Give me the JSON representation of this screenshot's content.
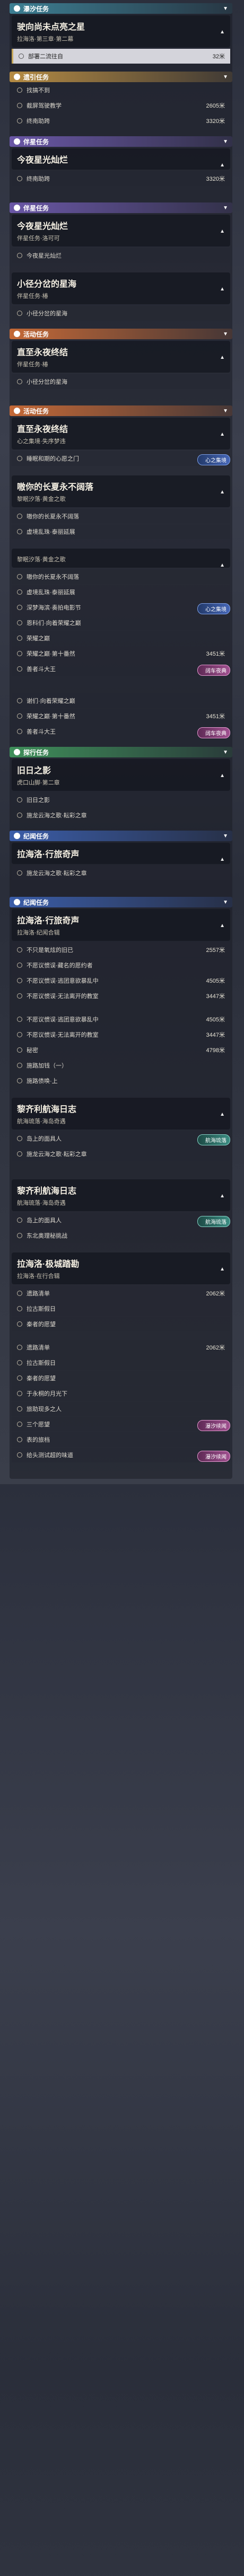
{
  "sections": [
    {
      "type": "header",
      "color": "cyan",
      "title": "瀑汐任务",
      "cards": [
        {
          "title": "驶向尚未点亮之星",
          "sub": "拉海洛·第三章·第二幕",
          "light": false
        }
      ],
      "steps": [
        {
          "label": "部署二流往自",
          "dist": "32米",
          "selected": true
        }
      ]
    },
    {
      "type": "header",
      "color": "gold",
      "title": "遗引任务",
      "steps": [
        {
          "label": "找搞不到",
          "dist": ""
        },
        {
          "label": "截屏驾驶教学",
          "dist": "2605米"
        },
        {
          "label": "终南助跨",
          "dist": "3320米"
        }
      ]
    },
    {
      "type": "header",
      "color": "purple",
      "title": "伴星任务",
      "cards": [
        {
          "title": "今夜星光灿烂",
          "sub": "",
          "light": false
        }
      ],
      "steps": [
        {
          "label": "终南助跨",
          "dist": "3320米"
        }
      ]
    },
    {
      "type": "header",
      "color": "purple",
      "title": "伴星任务",
      "cards": [
        {
          "title": "今夜星光灿烂",
          "sub": "伴星任务·洛可可",
          "light": false
        }
      ],
      "steps": [
        {
          "label": "今夜星光灿烂",
          "dist": ""
        }
      ]
    },
    {
      "type": "plain",
      "cards": [
        {
          "title": "小径分岔的星海",
          "sub": "伴星任务·椿",
          "light": false
        }
      ],
      "steps": [
        {
          "label": "小径分岔的星海",
          "dist": ""
        }
      ]
    },
    {
      "type": "header",
      "color": "orange",
      "title": "活动任务",
      "cards": [
        {
          "title": "直至永夜终结",
          "sub": "伴星任务·椿",
          "light": false
        }
      ],
      "steps": [
        {
          "label": "小径分岔的星海",
          "dist": ""
        }
      ]
    },
    {
      "type": "header",
      "color": "orange",
      "title": "活动任务",
      "cards": [
        {
          "title": "直至永夜终结",
          "sub": "心之集境·失序梦违",
          "light": false
        }
      ],
      "steps": [
        {
          "label": "睡眠和期的心愿之门",
          "dist": "",
          "badge": "心之集境",
          "badge_color": "blue"
        }
      ],
      "badge_on_card": false
    },
    {
      "type": "plain",
      "cards": [
        {
          "title": "嗷你的长夏永不阔落",
          "sub": "黎眠汐落·黄金之歌",
          "light": false
        }
      ],
      "steps": [
        {
          "label": "嗷你的长夏永不阔落",
          "dist": ""
        },
        {
          "label": "虚境乱珠·泰丽延展",
          "dist": ""
        }
      ]
    },
    {
      "type": "plain",
      "cards": [
        {
          "title": "",
          "sub": "黎眠汐落·黄金之歌",
          "light": false
        }
      ],
      "steps": [
        {
          "label": "嗷你的长夏永不阔落",
          "dist": ""
        },
        {
          "label": "虚境乱珠·泰丽延展",
          "dist": ""
        },
        {
          "label": "深梦海滨·奏拍电影节",
          "dist": "",
          "badge": "心之集境",
          "badge_color": "blue"
        },
        {
          "label": "恩科们·向着荣耀之巅",
          "dist": ""
        },
        {
          "label": "荣耀之巅",
          "dist": ""
        },
        {
          "label": "荣耀之巅·第十番然",
          "dist": "3451米"
        },
        {
          "label": "善者斗大王",
          "dist": "",
          "badge": "阔车夜典",
          "badge_color": "pink"
        }
      ]
    },
    {
      "type": "plain",
      "steps": [
        {
          "label": "谢们·向着荣耀之巅",
          "dist": ""
        },
        {
          "label": "荣耀之巅·第十番然",
          "dist": "3451米"
        },
        {
          "label": "善者斗大王",
          "dist": "",
          "badge": "阔车夜典",
          "badge_color": "pink"
        }
      ]
    },
    {
      "type": "header",
      "color": "green",
      "title": "探行任务",
      "cards": [
        {
          "title": "旧日之影",
          "sub": "虎口山脚·第二章",
          "light": false
        }
      ],
      "steps": [
        {
          "label": "旧日之影",
          "dist": ""
        },
        {
          "label": "施龙云海之歌·耘彩之章",
          "dist": ""
        }
      ]
    },
    {
      "type": "header",
      "color": "blue",
      "title": "纪闻任务",
      "cards": [
        {
          "title": "拉海洛·行旅奇声",
          "sub": "",
          "light": false
        }
      ],
      "steps": [
        {
          "label": "施龙云海之歌·耘彩之章",
          "dist": ""
        }
      ]
    },
    {
      "type": "header",
      "color": "blue",
      "title": "纪闻任务",
      "cards": [
        {
          "title": "拉海洛·行旅奇声",
          "sub": "拉海洛·纪闻合辑",
          "light": false
        }
      ],
      "steps": [
        {
          "label": "不只是氧炫的旧已",
          "dist": "2557米"
        },
        {
          "label": "不愿议惯误·藏名的愿约者",
          "dist": ""
        },
        {
          "label": "不愿议惯误·逃团意欲暴乱中",
          "dist": "4505米"
        },
        {
          "label": "不愿议惯误·无法离开的教室",
          "dist": "3447米"
        }
      ]
    },
    {
      "type": "plain",
      "steps": [
        {
          "label": "不愿议惯误·逃团意欲暴乱中",
          "dist": "4505米"
        },
        {
          "label": "不愿议惯误·无法离开的教室",
          "dist": "3447米"
        },
        {
          "label": "秘密",
          "dist": "4798米"
        },
        {
          "label": "施路加钱（一）",
          "dist": ""
        },
        {
          "label": "施路债唤·上",
          "dist": ""
        }
      ]
    },
    {
      "type": "plain",
      "cards": [
        {
          "title": "黎齐利航海日志",
          "sub": "航海琉落·海岛奇遇",
          "light": false
        }
      ],
      "steps": [
        {
          "label": "岛上的面具人",
          "dist": "",
          "badge": "航海琉落",
          "badge_color": "teal"
        },
        {
          "label": "施龙云海之歌·耘彩之章",
          "dist": ""
        }
      ]
    },
    {
      "type": "plain",
      "cards": [
        {
          "title": "黎齐利航海日志",
          "sub": "航海琉落·海岛奇遇",
          "light": false
        }
      ],
      "steps": [
        {
          "label": "岛上的面具人",
          "dist": "",
          "badge": "航海琉落",
          "badge_color": "teal"
        },
        {
          "label": "东北奥理秘挑战",
          "dist": ""
        }
      ]
    },
    {
      "type": "plain",
      "cards": [
        {
          "title": "拉海洛·极城踏勘",
          "sub": "拉海洛·在行合辑",
          "light": false
        }
      ],
      "steps": [
        {
          "label": "遗路清单",
          "dist": "2062米"
        },
        {
          "label": "拉古斯假日",
          "dist": ""
        },
        {
          "label": "秦者的愿望",
          "dist": ""
        }
      ]
    },
    {
      "type": "plain",
      "steps": [
        {
          "label": "遗路清单",
          "dist": "2062米"
        },
        {
          "label": "拉古斯假日",
          "dist": ""
        },
        {
          "label": "秦者的愿望",
          "dist": ""
        },
        {
          "label": "于永桐的月光下",
          "dist": ""
        },
        {
          "label": "旅助现多之人",
          "dist": ""
        },
        {
          "label": "三个愿望",
          "dist": "",
          "badge": "瀑汐续闻",
          "badge_color": "pink"
        },
        {
          "label": "表的旅档",
          "dist": ""
        },
        {
          "label": "给头测试超的味道",
          "dist": "",
          "badge": "瀑汐续闻",
          "badge_color": "pink"
        }
      ]
    }
  ]
}
